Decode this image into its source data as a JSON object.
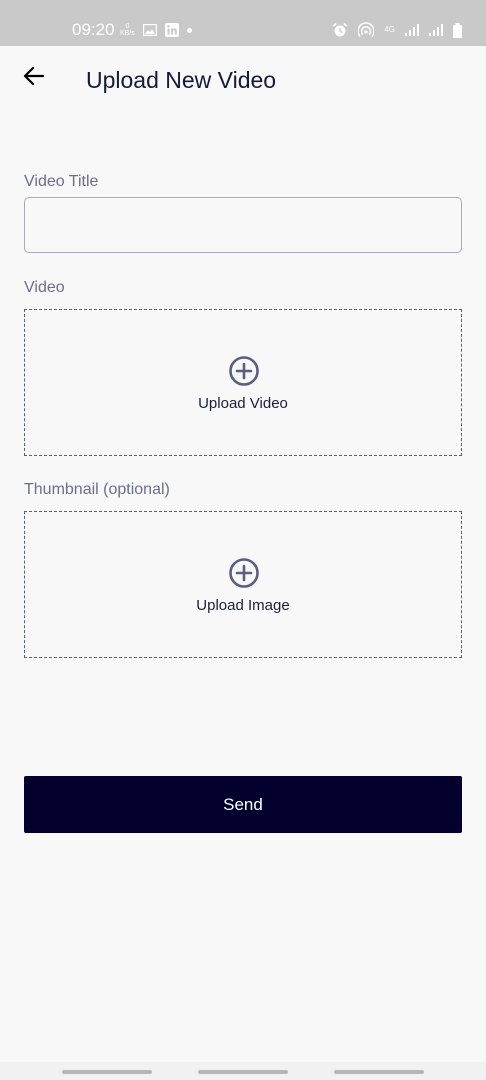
{
  "status_bar": {
    "time": "09:20",
    "speed_value": "0",
    "speed_unit": "KB/s",
    "network": "4G"
  },
  "header": {
    "title": "Upload New Video"
  },
  "form": {
    "title_label": "Video Title",
    "title_value": "",
    "title_placeholder": "",
    "video_label": "Video",
    "video_upload_label": "Upload Video",
    "thumbnail_label": "Thumbnail (optional)",
    "thumbnail_upload_label": "Upload Image",
    "send_label": "Send"
  },
  "colors": {
    "primary": "#03002d",
    "title_text": "#141a3a",
    "label_text": "#6b6f8c",
    "dashed_border": "#5a5f82",
    "status_bar_bg": "#c9c9c9",
    "page_bg": "#f8f8f9"
  }
}
